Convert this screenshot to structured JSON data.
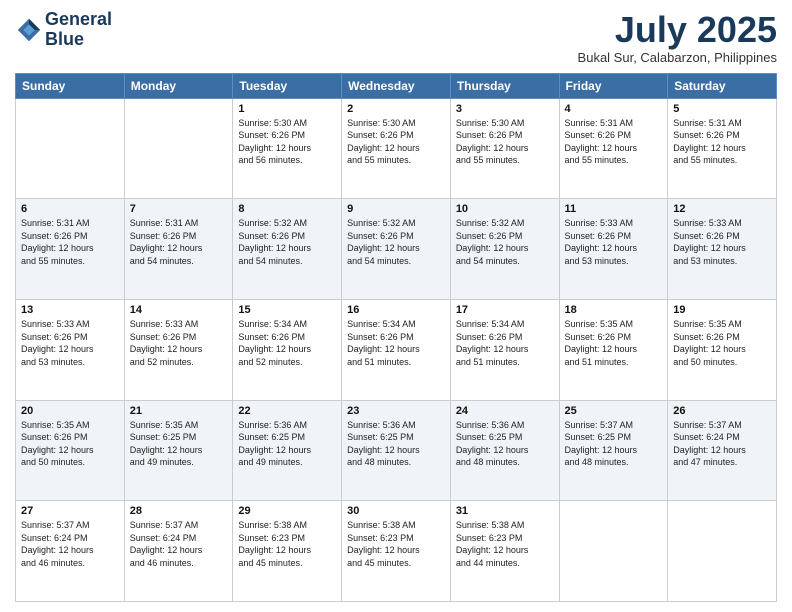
{
  "header": {
    "logo_line1": "General",
    "logo_line2": "Blue",
    "month_title": "July 2025",
    "location": "Bukal Sur, Calabarzon, Philippines"
  },
  "weekdays": [
    "Sunday",
    "Monday",
    "Tuesday",
    "Wednesday",
    "Thursday",
    "Friday",
    "Saturday"
  ],
  "weeks": [
    [
      {
        "day": "",
        "info": ""
      },
      {
        "day": "",
        "info": ""
      },
      {
        "day": "1",
        "info": "Sunrise: 5:30 AM\nSunset: 6:26 PM\nDaylight: 12 hours\nand 56 minutes."
      },
      {
        "day": "2",
        "info": "Sunrise: 5:30 AM\nSunset: 6:26 PM\nDaylight: 12 hours\nand 55 minutes."
      },
      {
        "day": "3",
        "info": "Sunrise: 5:30 AM\nSunset: 6:26 PM\nDaylight: 12 hours\nand 55 minutes."
      },
      {
        "day": "4",
        "info": "Sunrise: 5:31 AM\nSunset: 6:26 PM\nDaylight: 12 hours\nand 55 minutes."
      },
      {
        "day": "5",
        "info": "Sunrise: 5:31 AM\nSunset: 6:26 PM\nDaylight: 12 hours\nand 55 minutes."
      }
    ],
    [
      {
        "day": "6",
        "info": "Sunrise: 5:31 AM\nSunset: 6:26 PM\nDaylight: 12 hours\nand 55 minutes."
      },
      {
        "day": "7",
        "info": "Sunrise: 5:31 AM\nSunset: 6:26 PM\nDaylight: 12 hours\nand 54 minutes."
      },
      {
        "day": "8",
        "info": "Sunrise: 5:32 AM\nSunset: 6:26 PM\nDaylight: 12 hours\nand 54 minutes."
      },
      {
        "day": "9",
        "info": "Sunrise: 5:32 AM\nSunset: 6:26 PM\nDaylight: 12 hours\nand 54 minutes."
      },
      {
        "day": "10",
        "info": "Sunrise: 5:32 AM\nSunset: 6:26 PM\nDaylight: 12 hours\nand 54 minutes."
      },
      {
        "day": "11",
        "info": "Sunrise: 5:33 AM\nSunset: 6:26 PM\nDaylight: 12 hours\nand 53 minutes."
      },
      {
        "day": "12",
        "info": "Sunrise: 5:33 AM\nSunset: 6:26 PM\nDaylight: 12 hours\nand 53 minutes."
      }
    ],
    [
      {
        "day": "13",
        "info": "Sunrise: 5:33 AM\nSunset: 6:26 PM\nDaylight: 12 hours\nand 53 minutes."
      },
      {
        "day": "14",
        "info": "Sunrise: 5:33 AM\nSunset: 6:26 PM\nDaylight: 12 hours\nand 52 minutes."
      },
      {
        "day": "15",
        "info": "Sunrise: 5:34 AM\nSunset: 6:26 PM\nDaylight: 12 hours\nand 52 minutes."
      },
      {
        "day": "16",
        "info": "Sunrise: 5:34 AM\nSunset: 6:26 PM\nDaylight: 12 hours\nand 51 minutes."
      },
      {
        "day": "17",
        "info": "Sunrise: 5:34 AM\nSunset: 6:26 PM\nDaylight: 12 hours\nand 51 minutes."
      },
      {
        "day": "18",
        "info": "Sunrise: 5:35 AM\nSunset: 6:26 PM\nDaylight: 12 hours\nand 51 minutes."
      },
      {
        "day": "19",
        "info": "Sunrise: 5:35 AM\nSunset: 6:26 PM\nDaylight: 12 hours\nand 50 minutes."
      }
    ],
    [
      {
        "day": "20",
        "info": "Sunrise: 5:35 AM\nSunset: 6:26 PM\nDaylight: 12 hours\nand 50 minutes."
      },
      {
        "day": "21",
        "info": "Sunrise: 5:35 AM\nSunset: 6:25 PM\nDaylight: 12 hours\nand 49 minutes."
      },
      {
        "day": "22",
        "info": "Sunrise: 5:36 AM\nSunset: 6:25 PM\nDaylight: 12 hours\nand 49 minutes."
      },
      {
        "day": "23",
        "info": "Sunrise: 5:36 AM\nSunset: 6:25 PM\nDaylight: 12 hours\nand 48 minutes."
      },
      {
        "day": "24",
        "info": "Sunrise: 5:36 AM\nSunset: 6:25 PM\nDaylight: 12 hours\nand 48 minutes."
      },
      {
        "day": "25",
        "info": "Sunrise: 5:37 AM\nSunset: 6:25 PM\nDaylight: 12 hours\nand 48 minutes."
      },
      {
        "day": "26",
        "info": "Sunrise: 5:37 AM\nSunset: 6:24 PM\nDaylight: 12 hours\nand 47 minutes."
      }
    ],
    [
      {
        "day": "27",
        "info": "Sunrise: 5:37 AM\nSunset: 6:24 PM\nDaylight: 12 hours\nand 46 minutes."
      },
      {
        "day": "28",
        "info": "Sunrise: 5:37 AM\nSunset: 6:24 PM\nDaylight: 12 hours\nand 46 minutes."
      },
      {
        "day": "29",
        "info": "Sunrise: 5:38 AM\nSunset: 6:23 PM\nDaylight: 12 hours\nand 45 minutes."
      },
      {
        "day": "30",
        "info": "Sunrise: 5:38 AM\nSunset: 6:23 PM\nDaylight: 12 hours\nand 45 minutes."
      },
      {
        "day": "31",
        "info": "Sunrise: 5:38 AM\nSunset: 6:23 PM\nDaylight: 12 hours\nand 44 minutes."
      },
      {
        "day": "",
        "info": ""
      },
      {
        "day": "",
        "info": ""
      }
    ]
  ]
}
